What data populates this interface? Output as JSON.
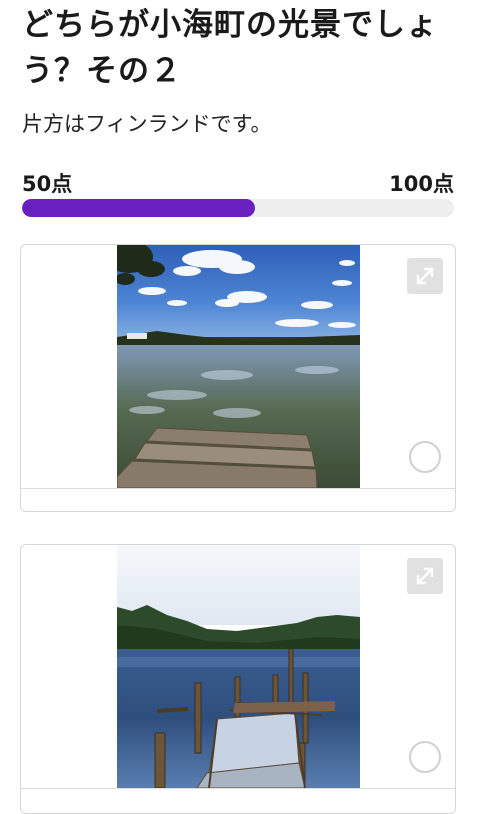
{
  "quiz": {
    "title": "どちらが小海町の光景でしょう？その２",
    "subtitle": "片方はフィンランドです。"
  },
  "score": {
    "min_label": "50点",
    "max_label": "100点",
    "progress_fraction": 0.54
  },
  "options": [
    {
      "name": "option-1",
      "expand_icon": "expand-icon",
      "selected": false
    },
    {
      "name": "option-2",
      "expand_icon": "expand-icon",
      "selected": false
    }
  ],
  "colors": {
    "accent": "#6a1fc0",
    "track": "#eeeeee",
    "border": "#d6d6d6"
  }
}
